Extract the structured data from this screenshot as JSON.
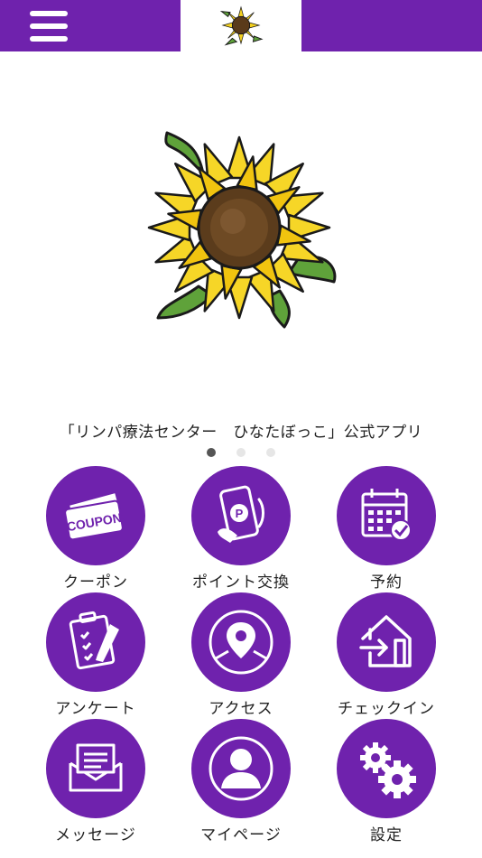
{
  "header": {
    "menu_icon": "hamburger-icon",
    "logo_icon": "sunflower-logo-icon"
  },
  "banner": {
    "image_icon": "sunflower-banner-image",
    "caption": "「リンパ療法センター　ひなたぼっこ」公式アプリ",
    "slide_count": 3,
    "active_slide": 1
  },
  "menu": {
    "items": [
      {
        "label": "クーポン",
        "icon": "coupon-icon"
      },
      {
        "label": "ポイント交換",
        "icon": "point-exchange-icon"
      },
      {
        "label": "予約",
        "icon": "calendar-icon"
      },
      {
        "label": "アンケート",
        "icon": "clipboard-icon"
      },
      {
        "label": "アクセス",
        "icon": "map-pin-icon"
      },
      {
        "label": "チェックイン",
        "icon": "checkin-icon"
      },
      {
        "label": "メッセージ",
        "icon": "envelope-icon"
      },
      {
        "label": "マイページ",
        "icon": "person-icon"
      },
      {
        "label": "設定",
        "icon": "gear-icon"
      }
    ]
  },
  "colors": {
    "primary": "#6f22ad",
    "background": "#ffffff",
    "text": "#222222"
  }
}
